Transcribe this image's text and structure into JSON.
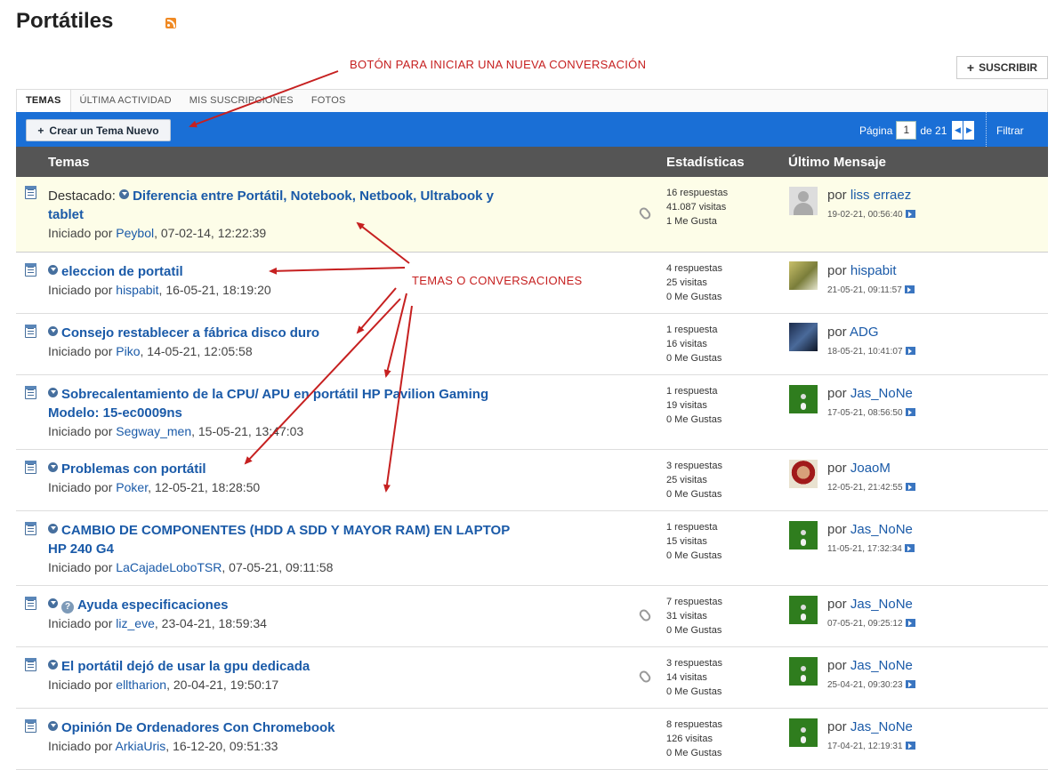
{
  "page": {
    "title": "Portátiles"
  },
  "header": {
    "subscribe_label": "SUSCRIBIR"
  },
  "tabs": [
    {
      "label": "TEMAS"
    },
    {
      "label": "ÚLTIMA ACTIVIDAD"
    },
    {
      "label": "MIS SUSCRIPCIONES"
    },
    {
      "label": "FOTOS"
    }
  ],
  "toolbar": {
    "new_topic_label": "Crear un Tema Nuevo",
    "page_label": "Página",
    "page_current": "1",
    "page_of": "de 21",
    "filter_label": "Filtrar"
  },
  "table_head": {
    "topics": "Temas",
    "stats": "Estadísticas",
    "last": "Último Mensaje"
  },
  "rows": [
    {
      "prefix": "Destacado:",
      "title_a": "Diferencia entre Portátil, Notebook, Netbook, Ultrabook y",
      "title_b": "tablet",
      "started_label": "Iniciado por",
      "author": "Peybol",
      "date": ", 07-02-14, 12:22:39",
      "replies": "16 respuestas",
      "views": "41.087 visitas",
      "likes": "1 Me Gusta",
      "by_label": "por",
      "last_user": "liss erraez",
      "last_date": "19-02-21, 00:56:40"
    },
    {
      "title_a": "eleccion de portatil",
      "started_label": "Iniciado por",
      "author": "hispabit",
      "date": ", 16-05-21, 18:19:20",
      "replies": "4 respuestas",
      "views": "25 visitas",
      "likes": "0 Me Gustas",
      "by_label": "por",
      "last_user": "hispabit",
      "last_date": "21-05-21, 09:11:57"
    },
    {
      "title_a": "Consejo restablecer a fábrica disco duro",
      "started_label": "Iniciado por",
      "author": "Piko",
      "date": ", 14-05-21, 12:05:58",
      "replies": "1 respuesta",
      "views": "16 visitas",
      "likes": "0 Me Gustas",
      "by_label": "por",
      "last_user": "ADG",
      "last_date": "18-05-21, 10:41:07"
    },
    {
      "title_a": "Sobrecalentamiento de la CPU/ APU en portátil HP Pavilion Gaming",
      "title_b": "Modelo: 15-ec0009ns",
      "started_label": "Iniciado por",
      "author": "Segway_men",
      "date": ", 15-05-21, 13:47:03",
      "replies": "1 respuesta",
      "views": "19 visitas",
      "likes": "0 Me Gustas",
      "by_label": "por",
      "last_user": "Jas_NoNe",
      "last_date": "17-05-21, 08:56:50"
    },
    {
      "title_a": "Problemas con portátil",
      "started_label": "Iniciado por",
      "author": "Poker",
      "date": ", 12-05-21, 18:28:50",
      "replies": "3 respuestas",
      "views": "25 visitas",
      "likes": "0 Me Gustas",
      "by_label": "por",
      "last_user": "JoaoM",
      "last_date": "12-05-21, 21:42:55"
    },
    {
      "title_a": "CAMBIO DE COMPONENTES (HDD A SDD Y MAYOR RAM) EN LAPTOP",
      "title_b": "HP 240 G4",
      "started_label": "Iniciado por",
      "author": "LaCajadeLoboTSR",
      "date": ", 07-05-21, 09:11:58",
      "replies": "1 respuesta",
      "views": "15 visitas",
      "likes": "0 Me Gustas",
      "by_label": "por",
      "last_user": "Jas_NoNe",
      "last_date": "11-05-21, 17:32:34"
    },
    {
      "title_a": "Ayuda especificaciones",
      "started_label": "Iniciado por",
      "author": "liz_eve",
      "date": ", 23-04-21, 18:59:34",
      "replies": "7 respuestas",
      "views": "31 visitas",
      "likes": "0 Me Gustas",
      "by_label": "por",
      "last_user": "Jas_NoNe",
      "last_date": "07-05-21, 09:25:12"
    },
    {
      "title_a": "El portátil dejó de usar la gpu dedicada",
      "started_label": "Iniciado por",
      "author": "elltharion",
      "date": ", 20-04-21, 19:50:17",
      "replies": "3 respuestas",
      "views": "14 visitas",
      "likes": "0 Me Gustas",
      "by_label": "por",
      "last_user": "Jas_NoNe",
      "last_date": "25-04-21, 09:30:23"
    },
    {
      "title_a": "Opinión De Ordenadores Con Chromebook",
      "started_label": "Iniciado por",
      "author": "ArkiaUris",
      "date": ", 16-12-20, 09:51:33",
      "replies": "8 respuestas",
      "views": "126 visitas",
      "likes": "0 Me Gustas",
      "by_label": "por",
      "last_user": "Jas_NoNe",
      "last_date": "17-04-21, 12:19:31"
    }
  ],
  "annotations": {
    "button_note": "BOTÓN PARA INICIAR UNA NUEVA CONVERSACIÓN",
    "topics_note": "TEMAS O CONVERSACIONES",
    "color": "#c62020"
  },
  "colors": {
    "toolbar": "#1a6fd6",
    "header": "#555555",
    "link": "#1a5aa8",
    "sticky_bg": "#fdfde8"
  }
}
